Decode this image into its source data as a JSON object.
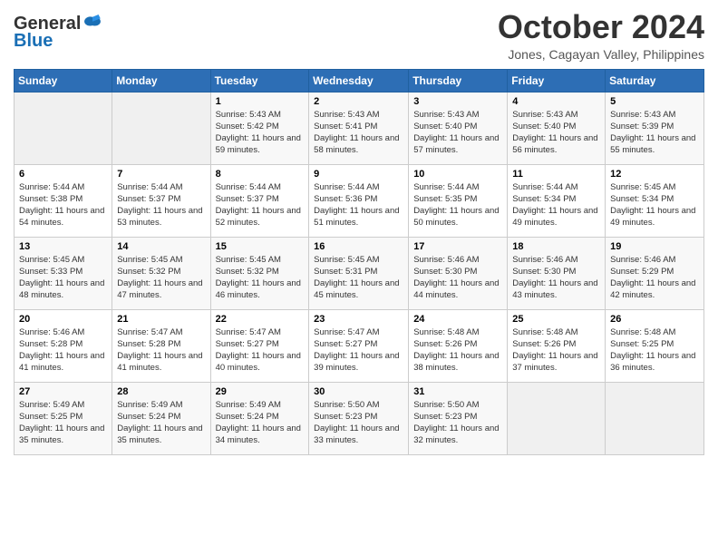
{
  "header": {
    "logo_line1": "General",
    "logo_line2": "Blue",
    "month_title": "October 2024",
    "location": "Jones, Cagayan Valley, Philippines"
  },
  "days_of_week": [
    "Sunday",
    "Monday",
    "Tuesday",
    "Wednesday",
    "Thursday",
    "Friday",
    "Saturday"
  ],
  "weeks": [
    [
      {
        "day": "",
        "sunrise": "",
        "sunset": "",
        "daylight": "",
        "empty": true
      },
      {
        "day": "",
        "sunrise": "",
        "sunset": "",
        "daylight": "",
        "empty": true
      },
      {
        "day": "1",
        "sunrise": "Sunrise: 5:43 AM",
        "sunset": "Sunset: 5:42 PM",
        "daylight": "Daylight: 11 hours and 59 minutes.",
        "empty": false
      },
      {
        "day": "2",
        "sunrise": "Sunrise: 5:43 AM",
        "sunset": "Sunset: 5:41 PM",
        "daylight": "Daylight: 11 hours and 58 minutes.",
        "empty": false
      },
      {
        "day": "3",
        "sunrise": "Sunrise: 5:43 AM",
        "sunset": "Sunset: 5:40 PM",
        "daylight": "Daylight: 11 hours and 57 minutes.",
        "empty": false
      },
      {
        "day": "4",
        "sunrise": "Sunrise: 5:43 AM",
        "sunset": "Sunset: 5:40 PM",
        "daylight": "Daylight: 11 hours and 56 minutes.",
        "empty": false
      },
      {
        "day": "5",
        "sunrise": "Sunrise: 5:43 AM",
        "sunset": "Sunset: 5:39 PM",
        "daylight": "Daylight: 11 hours and 55 minutes.",
        "empty": false
      }
    ],
    [
      {
        "day": "6",
        "sunrise": "Sunrise: 5:44 AM",
        "sunset": "Sunset: 5:38 PM",
        "daylight": "Daylight: 11 hours and 54 minutes.",
        "empty": false
      },
      {
        "day": "7",
        "sunrise": "Sunrise: 5:44 AM",
        "sunset": "Sunset: 5:37 PM",
        "daylight": "Daylight: 11 hours and 53 minutes.",
        "empty": false
      },
      {
        "day": "8",
        "sunrise": "Sunrise: 5:44 AM",
        "sunset": "Sunset: 5:37 PM",
        "daylight": "Daylight: 11 hours and 52 minutes.",
        "empty": false
      },
      {
        "day": "9",
        "sunrise": "Sunrise: 5:44 AM",
        "sunset": "Sunset: 5:36 PM",
        "daylight": "Daylight: 11 hours and 51 minutes.",
        "empty": false
      },
      {
        "day": "10",
        "sunrise": "Sunrise: 5:44 AM",
        "sunset": "Sunset: 5:35 PM",
        "daylight": "Daylight: 11 hours and 50 minutes.",
        "empty": false
      },
      {
        "day": "11",
        "sunrise": "Sunrise: 5:44 AM",
        "sunset": "Sunset: 5:34 PM",
        "daylight": "Daylight: 11 hours and 49 minutes.",
        "empty": false
      },
      {
        "day": "12",
        "sunrise": "Sunrise: 5:45 AM",
        "sunset": "Sunset: 5:34 PM",
        "daylight": "Daylight: 11 hours and 49 minutes.",
        "empty": false
      }
    ],
    [
      {
        "day": "13",
        "sunrise": "Sunrise: 5:45 AM",
        "sunset": "Sunset: 5:33 PM",
        "daylight": "Daylight: 11 hours and 48 minutes.",
        "empty": false
      },
      {
        "day": "14",
        "sunrise": "Sunrise: 5:45 AM",
        "sunset": "Sunset: 5:32 PM",
        "daylight": "Daylight: 11 hours and 47 minutes.",
        "empty": false
      },
      {
        "day": "15",
        "sunrise": "Sunrise: 5:45 AM",
        "sunset": "Sunset: 5:32 PM",
        "daylight": "Daylight: 11 hours and 46 minutes.",
        "empty": false
      },
      {
        "day": "16",
        "sunrise": "Sunrise: 5:45 AM",
        "sunset": "Sunset: 5:31 PM",
        "daylight": "Daylight: 11 hours and 45 minutes.",
        "empty": false
      },
      {
        "day": "17",
        "sunrise": "Sunrise: 5:46 AM",
        "sunset": "Sunset: 5:30 PM",
        "daylight": "Daylight: 11 hours and 44 minutes.",
        "empty": false
      },
      {
        "day": "18",
        "sunrise": "Sunrise: 5:46 AM",
        "sunset": "Sunset: 5:30 PM",
        "daylight": "Daylight: 11 hours and 43 minutes.",
        "empty": false
      },
      {
        "day": "19",
        "sunrise": "Sunrise: 5:46 AM",
        "sunset": "Sunset: 5:29 PM",
        "daylight": "Daylight: 11 hours and 42 minutes.",
        "empty": false
      }
    ],
    [
      {
        "day": "20",
        "sunrise": "Sunrise: 5:46 AM",
        "sunset": "Sunset: 5:28 PM",
        "daylight": "Daylight: 11 hours and 41 minutes.",
        "empty": false
      },
      {
        "day": "21",
        "sunrise": "Sunrise: 5:47 AM",
        "sunset": "Sunset: 5:28 PM",
        "daylight": "Daylight: 11 hours and 41 minutes.",
        "empty": false
      },
      {
        "day": "22",
        "sunrise": "Sunrise: 5:47 AM",
        "sunset": "Sunset: 5:27 PM",
        "daylight": "Daylight: 11 hours and 40 minutes.",
        "empty": false
      },
      {
        "day": "23",
        "sunrise": "Sunrise: 5:47 AM",
        "sunset": "Sunset: 5:27 PM",
        "daylight": "Daylight: 11 hours and 39 minutes.",
        "empty": false
      },
      {
        "day": "24",
        "sunrise": "Sunrise: 5:48 AM",
        "sunset": "Sunset: 5:26 PM",
        "daylight": "Daylight: 11 hours and 38 minutes.",
        "empty": false
      },
      {
        "day": "25",
        "sunrise": "Sunrise: 5:48 AM",
        "sunset": "Sunset: 5:26 PM",
        "daylight": "Daylight: 11 hours and 37 minutes.",
        "empty": false
      },
      {
        "day": "26",
        "sunrise": "Sunrise: 5:48 AM",
        "sunset": "Sunset: 5:25 PM",
        "daylight": "Daylight: 11 hours and 36 minutes.",
        "empty": false
      }
    ],
    [
      {
        "day": "27",
        "sunrise": "Sunrise: 5:49 AM",
        "sunset": "Sunset: 5:25 PM",
        "daylight": "Daylight: 11 hours and 35 minutes.",
        "empty": false
      },
      {
        "day": "28",
        "sunrise": "Sunrise: 5:49 AM",
        "sunset": "Sunset: 5:24 PM",
        "daylight": "Daylight: 11 hours and 35 minutes.",
        "empty": false
      },
      {
        "day": "29",
        "sunrise": "Sunrise: 5:49 AM",
        "sunset": "Sunset: 5:24 PM",
        "daylight": "Daylight: 11 hours and 34 minutes.",
        "empty": false
      },
      {
        "day": "30",
        "sunrise": "Sunrise: 5:50 AM",
        "sunset": "Sunset: 5:23 PM",
        "daylight": "Daylight: 11 hours and 33 minutes.",
        "empty": false
      },
      {
        "day": "31",
        "sunrise": "Sunrise: 5:50 AM",
        "sunset": "Sunset: 5:23 PM",
        "daylight": "Daylight: 11 hours and 32 minutes.",
        "empty": false
      },
      {
        "day": "",
        "sunrise": "",
        "sunset": "",
        "daylight": "",
        "empty": true
      },
      {
        "day": "",
        "sunrise": "",
        "sunset": "",
        "daylight": "",
        "empty": true
      }
    ]
  ]
}
